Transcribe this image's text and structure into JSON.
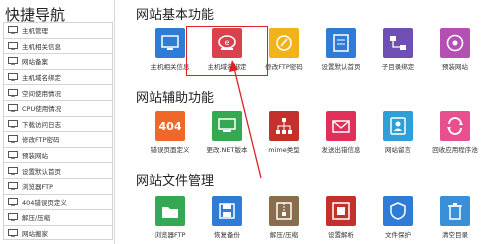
{
  "sidebar": {
    "title": "快捷导航",
    "items": [
      {
        "label": "主机管理",
        "icon": "monitor-icon"
      },
      {
        "label": "主机相关信息",
        "icon": "monitor-icon"
      },
      {
        "label": "网站备案",
        "icon": "document-icon"
      },
      {
        "label": "主机域名绑定",
        "icon": "monitor-icon"
      },
      {
        "label": "空间使用情况",
        "icon": "disk-icon"
      },
      {
        "label": "CPU使用情况",
        "icon": "cpu-icon"
      },
      {
        "label": "下载访问日志",
        "icon": "download-icon"
      },
      {
        "label": "修改FTP密码",
        "icon": "key-icon"
      },
      {
        "label": "预装网站",
        "icon": "install-icon"
      },
      {
        "label": "设置默认首页",
        "icon": "home-icon"
      },
      {
        "label": "浏览器FTP",
        "icon": "folder-icon"
      },
      {
        "label": "404错误页定义",
        "icon": "error-icon"
      },
      {
        "label": "解压/压缩",
        "icon": "zip-icon"
      },
      {
        "label": "网站搬家",
        "icon": "move-icon"
      }
    ]
  },
  "sections": [
    {
      "title": "网站基本功能",
      "tiles": [
        {
          "label": "主机相关信息",
          "color": "#2e7cd6",
          "icon": "info-icon"
        },
        {
          "label": "主机域名绑定",
          "color": "#d9414f",
          "icon": "domain-bind-icon"
        },
        {
          "label": "修改FTP密码",
          "color": "#f2b21b",
          "icon": "edit-key-icon"
        },
        {
          "label": "设置默认首页",
          "color": "#2e7cd6",
          "icon": "homepage-icon"
        },
        {
          "label": "子目录绑定",
          "color": "#6f4fb3",
          "icon": "subdir-icon"
        },
        {
          "label": "预装网站",
          "color": "#b44fb4",
          "icon": "disc-icon"
        }
      ]
    },
    {
      "title": "网站辅助功能",
      "tiles": [
        {
          "label": "错误页面定义",
          "color": "#f0672a",
          "icon": "404-icon",
          "text": "404"
        },
        {
          "label": "更改.NET版本",
          "color": "#34a853",
          "icon": "net-icon"
        },
        {
          "label": "mime类型",
          "color": "#c4302b",
          "icon": "tree-icon"
        },
        {
          "label": "发送出错信息",
          "color": "#e0305a",
          "icon": "mail-icon"
        },
        {
          "label": "网站留言",
          "color": "#2e9fd9",
          "icon": "contact-icon"
        },
        {
          "label": "回收应用程序池",
          "color": "#e84f8f",
          "icon": "recycle-icon"
        }
      ]
    },
    {
      "title": "网站文件管理",
      "tiles": [
        {
          "label": "浏览器FTP",
          "color": "#34a853",
          "icon": "ftp-icon"
        },
        {
          "label": "恢复备份",
          "color": "#2e7cd6",
          "icon": "save-icon"
        },
        {
          "label": "解压/压缩",
          "color": "#8a6d4d",
          "icon": "zip-icon"
        },
        {
          "label": "设置解析",
          "color": "#c4302b",
          "icon": "lock-icon"
        },
        {
          "label": "文件保护",
          "color": "#2e7cd6",
          "icon": "shield-icon"
        },
        {
          "label": "清空目录",
          "color": "#3a8fd9",
          "icon": "trash-icon"
        }
      ]
    }
  ]
}
